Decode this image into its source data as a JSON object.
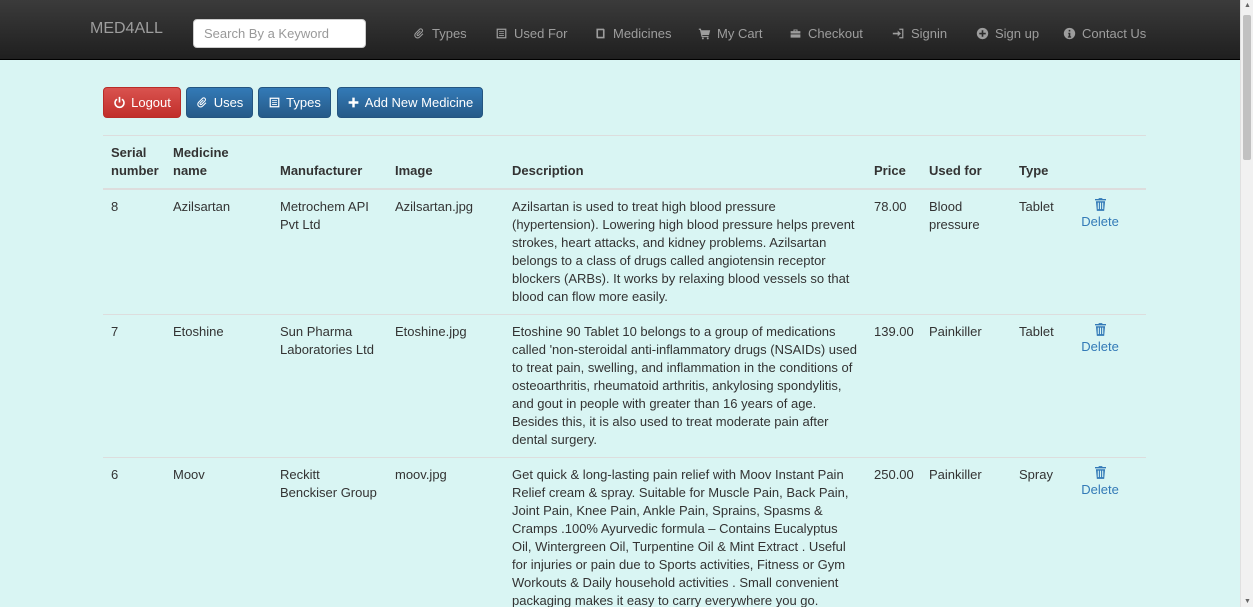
{
  "nav": {
    "brand": "MED4ALL",
    "search_placeholder": "Search By a Keyword",
    "items": [
      {
        "label": "Types",
        "icon": "paperclip-icon"
      },
      {
        "label": "Used For",
        "icon": "list-alt-icon"
      },
      {
        "label": "Medicines",
        "icon": "book-icon"
      },
      {
        "label": "My Cart",
        "icon": "shopping-cart-icon"
      },
      {
        "label": "Checkout",
        "icon": "briefcase-icon"
      },
      {
        "label": "Signin",
        "icon": "log-in-icon"
      },
      {
        "label": "Sign up",
        "icon": "plus-sign-icon"
      },
      {
        "label": "Contact Us",
        "icon": "info-sign-icon"
      }
    ]
  },
  "toolbar": {
    "logout": "Logout",
    "uses": "Uses",
    "types": "Types",
    "add": "Add New Medicine"
  },
  "table": {
    "headers": [
      "Serial number",
      "Medicine name",
      "Manufacturer",
      "Image",
      "Description",
      "Price",
      "Used for",
      "Type",
      ""
    ],
    "delete_label": "Delete",
    "rows": [
      {
        "serial": "8",
        "name": "Azilsartan",
        "manufacturer": "Metrochem API Pvt Ltd",
        "image": "Azilsartan.jpg",
        "description": "Azilsartan is used to treat high blood pressure (hypertension). Lowering high blood pressure helps prevent strokes, heart attacks, and kidney problems. Azilsartan belongs to a class of drugs called angiotensin receptor blockers (ARBs). It works by relaxing blood vessels so that blood can flow more easily.",
        "price": "78.00",
        "used_for": "Blood pressure",
        "type": "Tablet"
      },
      {
        "serial": "7",
        "name": "Etoshine",
        "manufacturer": "Sun Pharma Laboratories Ltd",
        "image": "Etoshine.jpg",
        "description": "Etoshine 90 Tablet 10 belongs to a group of medications called 'non-steroidal anti-inflammatory drugs (NSAIDs) used to treat pain, swelling, and inflammation in the conditions of osteoarthritis, rheumatoid arthritis, ankylosing spondylitis, and gout in people with greater than 16 years of age. Besides this, it is also used to treat moderate pain after dental surgery.",
        "price": "139.00",
        "used_for": "Painkiller",
        "type": "Tablet"
      },
      {
        "serial": "6",
        "name": "Moov",
        "manufacturer": "Reckitt Benckiser Group",
        "image": "moov.jpg",
        "description": "Get quick & long-lasting pain relief with Moov Instant Pain Relief cream & spray. Suitable for Muscle Pain, Back Pain, Joint Pain, Knee Pain, Ankle Pain, Sprains, Spasms & Cramps .100% Ayurvedic formula – Contains Eucalyptus Oil, Wintergreen Oil, Turpentine Oil & Mint Extract . Useful for injuries or pain due to Sports activities, Fitness or Gym Workouts & Daily household activities . Small convenient packaging makes it easy to carry everywhere you go.",
        "price": "250.00",
        "used_for": "Painkiller",
        "type": "Spray"
      }
    ]
  }
}
